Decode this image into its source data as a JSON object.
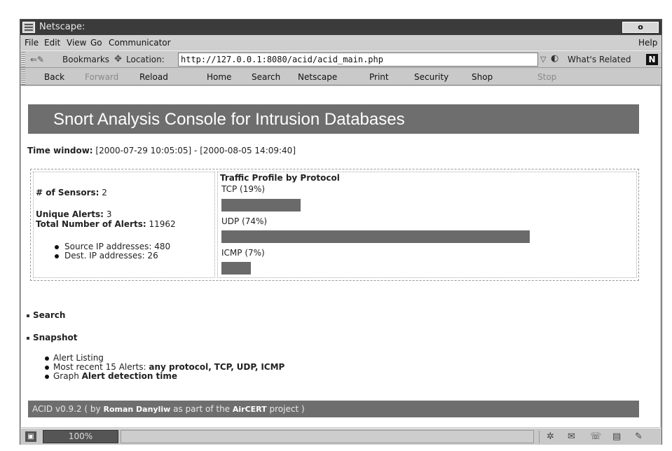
{
  "window": {
    "title": "Netscape:",
    "close_label": "o"
  },
  "menubar": {
    "items": [
      "File",
      "Edit",
      "View",
      "Go",
      "Communicator"
    ],
    "help": "Help"
  },
  "location_bar": {
    "bookmarks_label": "Bookmarks",
    "location_label": "Location:",
    "url": "http://127.0.0.1:8080/acid/acid_main.php",
    "whats_related_label": "What's Related",
    "netscape_logo": "N"
  },
  "toolbar": {
    "back": "Back",
    "forward": "Forward",
    "reload": "Reload",
    "home": "Home",
    "search": "Search",
    "netscape": "Netscape",
    "print": "Print",
    "security": "Security",
    "shop": "Shop",
    "stop": "Stop"
  },
  "page": {
    "banner": "Snort Analysis Console for Intrusion Databases",
    "time_window_label": "Time window:",
    "time_window_value": "[2000-07-29 10:05:05] - [2000-08-05 14:09:40]",
    "sensors_label": "# of Sensors:",
    "sensors_value": "2",
    "unique_alerts_label": "Unique Alerts:",
    "unique_alerts_value": "3",
    "total_alerts_label": "Total Number of Alerts:",
    "total_alerts_value": "11962",
    "source_ips": "Source IP addresses: 480",
    "dest_ips": "Dest. IP addresses: 26",
    "traffic_title": "Traffic Profile by Protocol",
    "protocols": [
      {
        "label": "TCP (19%)",
        "percent": 19
      },
      {
        "label": "UDP (74%)",
        "percent": 74
      },
      {
        "label": "ICMP (7%)",
        "percent": 7
      }
    ],
    "search_link": "Search",
    "snapshot_link": "Snapshot",
    "snapshot_items": {
      "alert_listing": "Alert Listing",
      "recent_prefix": "Most recent 15 Alerts:",
      "recent_any": "any protocol,",
      "recent_tcp": "TCP,",
      "recent_udp": "UDP,",
      "recent_icmp": "ICMP",
      "graph_prefix": "Graph",
      "graph_link": "Alert detection time"
    },
    "footer": {
      "prefix": "ACID v0.9.2 ( by",
      "author": "Roman Danyliw",
      "middle": "as part of the",
      "project": "AirCERT",
      "suffix": "project )"
    }
  },
  "statusbar": {
    "progress": "100%"
  }
}
